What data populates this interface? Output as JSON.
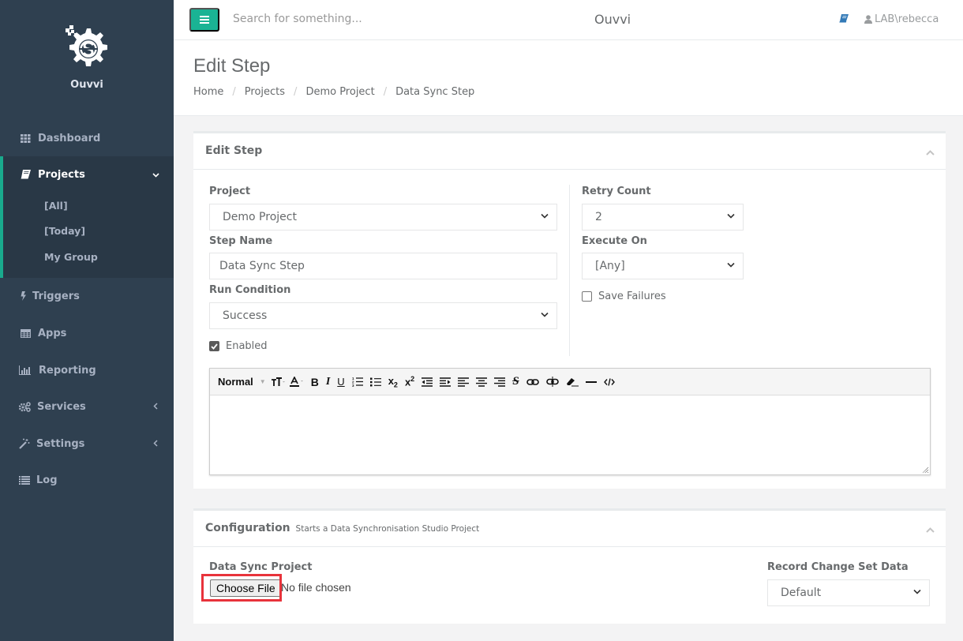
{
  "app": {
    "name": "Ouvvi",
    "title": "Ouvvi",
    "accent_color": "#1ab394",
    "sidebar_color": "#2f4050"
  },
  "sidebar": {
    "items": [
      {
        "label": "Dashboard",
        "icon": "grid-icon"
      },
      {
        "label": "Projects",
        "icon": "book-icon",
        "expanded": true
      },
      {
        "label": "Triggers",
        "icon": "bolt-icon"
      },
      {
        "label": "Apps",
        "icon": "table-icon"
      },
      {
        "label": "Reporting",
        "icon": "bar-chart-icon"
      },
      {
        "label": "Services",
        "icon": "cogs-icon"
      },
      {
        "label": "Settings",
        "icon": "magic-icon"
      },
      {
        "label": "Log",
        "icon": "list-icon"
      }
    ],
    "projects_sub": [
      {
        "label": "[All]"
      },
      {
        "label": "[Today]"
      },
      {
        "label": "My Group"
      }
    ]
  },
  "topbar": {
    "search_placeholder": "Search for something...",
    "user": "LAB\\rebecca"
  },
  "page": {
    "title": "Edit Step",
    "breadcrumb": [
      "Home",
      "Projects",
      "Demo Project",
      "Data Sync Step"
    ]
  },
  "edit_step": {
    "title": "Edit Step",
    "project": {
      "label": "Project",
      "value": "Demo Project"
    },
    "step_name": {
      "label": "Step Name",
      "value": "Data Sync Step"
    },
    "run_condition": {
      "label": "Run Condition",
      "value": "Success"
    },
    "enabled": {
      "label": "Enabled",
      "checked": true
    },
    "retry_count": {
      "label": "Retry Count",
      "value": "2"
    },
    "execute_on": {
      "label": "Execute On",
      "value": "[Any]"
    },
    "save_failures": {
      "label": "Save Failures",
      "checked": false
    },
    "editor": {
      "format_value": "Normal",
      "content": ""
    }
  },
  "configuration": {
    "title": "Configuration",
    "subtitle": "Starts a Data Synchronisation Studio Project",
    "data_sync_project": {
      "label": "Data Sync Project",
      "button": "Choose File",
      "status": "No file chosen"
    },
    "record_change_set": {
      "label": "Record Change Set Data",
      "value": "Default"
    }
  }
}
